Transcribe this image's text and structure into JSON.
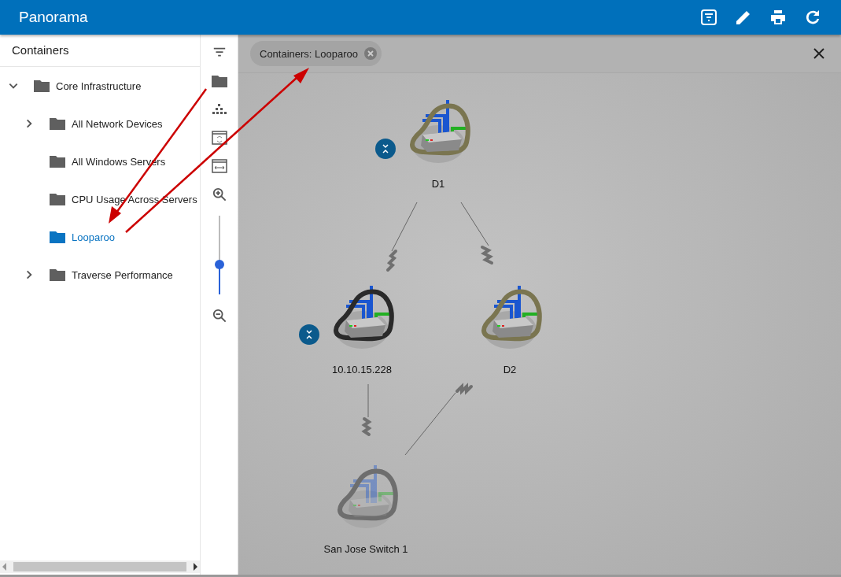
{
  "app_bar": {
    "title": "Panorama"
  },
  "sidebar": {
    "title": "Containers",
    "tree": [
      {
        "label": "Core Infrastructure",
        "expanded": true,
        "selected": false,
        "children": [
          {
            "label": "All Network Devices",
            "expanded": false,
            "selected": false
          },
          {
            "label": "All Windows Servers",
            "selected": false
          },
          {
            "label": "CPU Usage Across Servers",
            "selected": false
          },
          {
            "label": "Looparoo",
            "selected": true
          },
          {
            "label": "Traverse Performance",
            "expanded": false,
            "selected": false
          }
        ]
      }
    ]
  },
  "zoom_slider": {
    "level": 0.38
  },
  "filter_chip": {
    "label": "Containers: Looparoo"
  },
  "nodes": [
    {
      "label": "D1",
      "color": "#7a7550",
      "collapsible": true,
      "dimmed": false
    },
    {
      "label": "10.10.15.228",
      "color": "#2a2a2a",
      "collapsible": true,
      "dimmed": false
    },
    {
      "label": "D2",
      "color": "#7a7550",
      "collapsible": false,
      "dimmed": false
    },
    {
      "label": "San Jose Switch 1",
      "color": "#6e6e6e",
      "collapsible": false,
      "dimmed": true
    }
  ]
}
